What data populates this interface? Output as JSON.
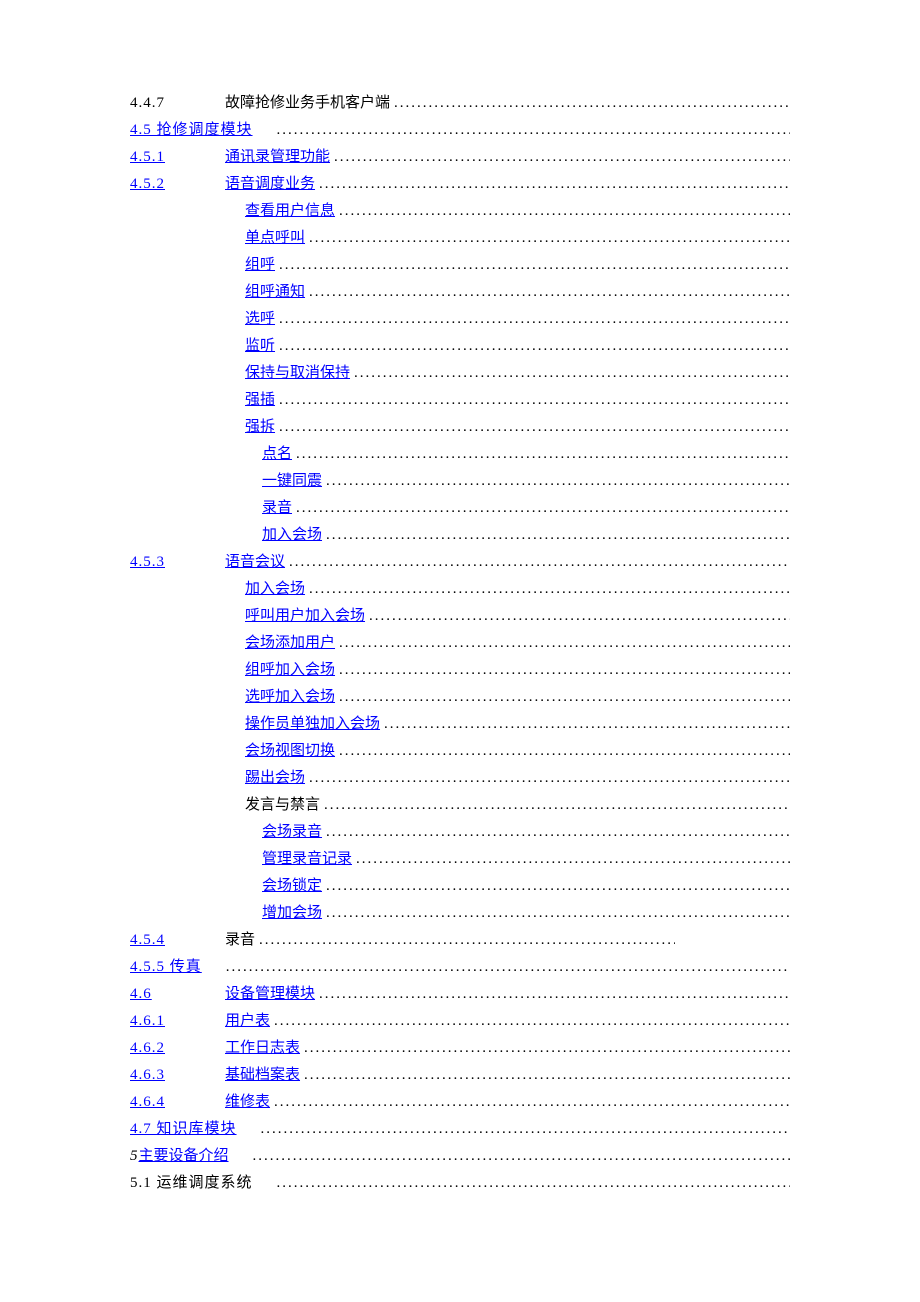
{
  "toc": [
    {
      "num": "4.4.7",
      "title": "故障抢修业务手机客户端",
      "numLink": false,
      "titleLink": false,
      "layout": "num"
    },
    {
      "num": "4.5 抢修调度模块",
      "title": "",
      "numLink": true,
      "titleLink": false,
      "layout": "combined"
    },
    {
      "num": "4.5.1",
      "title": "通讯录管理功能",
      "numLink": true,
      "titleLink": true,
      "layout": "num"
    },
    {
      "num": "4.5.2",
      "title": "语音调度业务",
      "numLink": true,
      "titleLink": true,
      "layout": "num"
    },
    {
      "num": "",
      "title": "查看用户信息",
      "numLink": false,
      "titleLink": true,
      "layout": "title"
    },
    {
      "num": "",
      "title": "单点呼叫",
      "numLink": false,
      "titleLink": true,
      "layout": "title"
    },
    {
      "num": "",
      "title": "组呼",
      "numLink": false,
      "titleLink": true,
      "layout": "title"
    },
    {
      "num": "",
      "title": "组呼通知",
      "numLink": false,
      "titleLink": true,
      "layout": "title"
    },
    {
      "num": "",
      "title": "选呼",
      "numLink": false,
      "titleLink": true,
      "layout": "title"
    },
    {
      "num": "",
      "title": "监听",
      "numLink": false,
      "titleLink": true,
      "layout": "title"
    },
    {
      "num": "",
      "title": "保持与取消保持",
      "numLink": false,
      "titleLink": true,
      "layout": "title"
    },
    {
      "num": "",
      "title": "强插",
      "numLink": false,
      "titleLink": true,
      "layout": "title"
    },
    {
      "num": "",
      "title": "强拆",
      "numLink": false,
      "titleLink": true,
      "layout": "title"
    },
    {
      "num": "",
      "title": "点名",
      "numLink": false,
      "titleLink": true,
      "layout": "title-deep"
    },
    {
      "num": "",
      "title": "一键同震",
      "numLink": false,
      "titleLink": true,
      "layout": "title-deep"
    },
    {
      "num": "",
      "title": "录音",
      "numLink": false,
      "titleLink": true,
      "layout": "title-deep"
    },
    {
      "num": "",
      "title": "加入会场",
      "numLink": false,
      "titleLink": true,
      "layout": "title-deep"
    },
    {
      "num": "4.5.3",
      "title": "语音会议",
      "numLink": true,
      "titleLink": true,
      "layout": "num"
    },
    {
      "num": "",
      "title": "加入会场",
      "numLink": false,
      "titleLink": true,
      "layout": "title"
    },
    {
      "num": "",
      "title": "呼叫用户加入会场",
      "numLink": false,
      "titleLink": true,
      "layout": "title"
    },
    {
      "num": "",
      "title": "会场添加用户",
      "numLink": false,
      "titleLink": true,
      "layout": "title"
    },
    {
      "num": "",
      "title": "组呼加入会场",
      "numLink": false,
      "titleLink": true,
      "layout": "title"
    },
    {
      "num": "",
      "title": "选呼加入会场",
      "numLink": false,
      "titleLink": true,
      "layout": "title"
    },
    {
      "num": "",
      "title": "操作员单独加入会场",
      "numLink": false,
      "titleLink": true,
      "layout": "title"
    },
    {
      "num": "",
      "title": "会场视图切换",
      "numLink": false,
      "titleLink": true,
      "layout": "title"
    },
    {
      "num": "",
      "title": "踢出会场",
      "numLink": false,
      "titleLink": true,
      "layout": "title"
    },
    {
      "num": "",
      "title": "发言与禁言",
      "numLink": false,
      "titleLink": false,
      "layout": "title"
    },
    {
      "num": "",
      "title": "会场录音",
      "numLink": false,
      "titleLink": true,
      "layout": "title-deep"
    },
    {
      "num": "",
      "title": "管理录音记录",
      "numLink": false,
      "titleLink": true,
      "layout": "title-deep"
    },
    {
      "num": "",
      "title": "会场锁定",
      "numLink": false,
      "titleLink": true,
      "layout": "title-deep"
    },
    {
      "num": "",
      "title": "增加会场",
      "numLink": false,
      "titleLink": true,
      "layout": "title-deep"
    },
    {
      "num": "4.5.4",
      "title": "录音",
      "numLink": true,
      "titleLink": false,
      "layout": "num-short"
    },
    {
      "num": "4.5.5 传真",
      "title": "",
      "numLink": true,
      "titleLink": false,
      "layout": "combined"
    },
    {
      "num": "4.6",
      "title": "设备管理模块",
      "numLink": true,
      "titleLink": true,
      "layout": "num-narrow"
    },
    {
      "num": "4.6.1",
      "title": "用户表",
      "numLink": true,
      "titleLink": true,
      "layout": "num"
    },
    {
      "num": "4.6.2",
      "title": "工作日志表",
      "numLink": true,
      "titleLink": true,
      "layout": "num"
    },
    {
      "num": "4.6.3",
      "title": "基础档案表",
      "numLink": true,
      "titleLink": true,
      "layout": "num"
    },
    {
      "num": "4.6.4",
      "title": "维修表",
      "numLink": true,
      "titleLink": true,
      "layout": "num"
    },
    {
      "num": "4.7 知识库模块",
      "title": "",
      "numLink": true,
      "titleLink": false,
      "layout": "combined"
    },
    {
      "num": "5",
      "title": "主要设备介绍",
      "numLink": false,
      "titleLink": true,
      "layout": "inline"
    },
    {
      "num": "5.1 运维调度系统",
      "title": "",
      "numLink": false,
      "titleLink": false,
      "layout": "combined-plain"
    }
  ],
  "dots": "........................................................................................................."
}
